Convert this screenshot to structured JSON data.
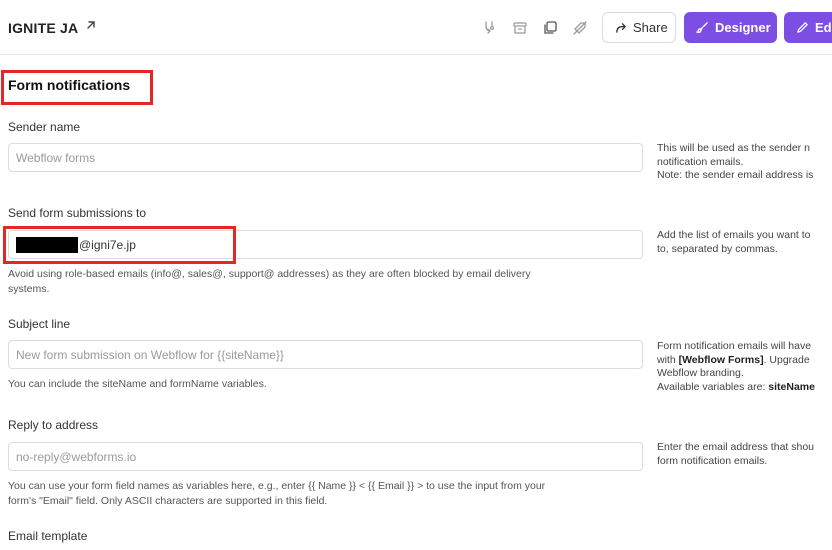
{
  "header": {
    "site_title": "IGNITE JA",
    "share_label": "Share",
    "designer_label": "Designer",
    "edit_label": "Edi"
  },
  "section_title": "Form notifications",
  "sender_name": {
    "label": "Sender name",
    "placeholder": "Webflow forms",
    "side_lines": [
      "This will be used as the sender n",
      "notification emails.",
      "Note: the sender email address is"
    ]
  },
  "send_to": {
    "label": "Send form submissions to",
    "value": "@igni7e.jp",
    "help_lines": [
      "Avoid using role-based emails (info@, sales@, support@ addresses) as they are often blocked by email delivery",
      "systems."
    ],
    "side_lines": [
      "Add the list of emails you want to",
      "to, separated by commas."
    ]
  },
  "subject": {
    "label": "Subject line",
    "placeholder": "New form submission on Webflow for {{siteName}}",
    "help": "You can include the siteName and formName variables.",
    "side_l1": "Form notification emails will have",
    "side_l2_pre": "with ",
    "side_l2_bold": "[Webflow Forms]",
    "side_l2_post": ". Upgrade",
    "side_l3": "Webflow branding.",
    "side_l4_pre": "Available variables are: ",
    "side_l4_bold": "siteName"
  },
  "reply_to": {
    "label": "Reply to address",
    "placeholder": "no-reply@webforms.io",
    "help_lines": [
      "You can use your form field names as variables here, e.g., enter {{ Name }} < {{ Email }} > to use the input from your",
      "form's \"Email\" field. Only ASCII characters are supported in this field."
    ],
    "side_lines": [
      "Enter the email address that shou",
      "form notification emails."
    ]
  },
  "email_template": {
    "label": "Email template"
  },
  "colors": {
    "accent": "#7c4ee4",
    "highlight": "#e32626"
  },
  "icons": [
    "external-link-icon",
    "merge-icon",
    "archive-icon",
    "duplicate-icon",
    "tag-off-icon",
    "share-arrow-icon",
    "pencil-icon"
  ]
}
